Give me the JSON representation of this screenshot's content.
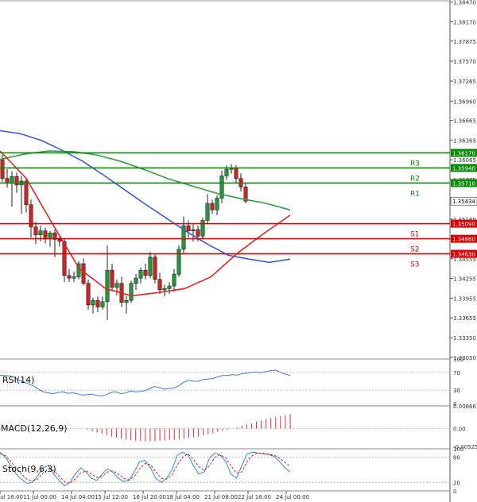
{
  "chart_data": {
    "type": "candlestick",
    "price_axis": {
      "ticks": [
        "1.38470",
        "1.38170",
        "1.37875",
        "1.37570",
        "1.37265",
        "1.36960",
        "1.36665",
        "1.36365",
        "1.36065",
        "1.35765",
        "1.35160",
        "1.34855",
        "1.34555",
        "1.34255",
        "1.33955",
        "1.33655",
        "1.33350",
        "1.33050"
      ],
      "tick_values": [
        1.3847,
        1.3817,
        1.37875,
        1.3757,
        1.37265,
        1.3696,
        1.36665,
        1.36365,
        1.36065,
        1.35765,
        1.3516,
        1.34855,
        1.34555,
        1.34255,
        1.33955,
        1.33655,
        1.3335,
        1.3305
      ],
      "ylim": [
        1.3305,
        1.3849
      ]
    },
    "time_axis": {
      "labels": [
        "10 Jul 16:00",
        "11 Jul 00:00",
        "14 Jul 04:00",
        "15 Jul 12:00",
        "16 Jul 20:00",
        "18 Jul 04:00",
        "21 Jul 08:00",
        "22 Jul 16:00",
        "24 Jul 00:00"
      ],
      "label_index": [
        0,
        7,
        15,
        22,
        30,
        37,
        45,
        52,
        60
      ]
    },
    "levels": [
      {
        "name": "R3",
        "value": 1.3617,
        "tag": "1.36170",
        "color": "#0a8a0a"
      },
      {
        "name": "R2",
        "value": 1.3594,
        "tag": "1.35940",
        "color": "#0a8a0a"
      },
      {
        "name": "R1",
        "value": 1.3571,
        "tag": "1.35710",
        "color": "#0a8a0a"
      },
      {
        "name": "S1",
        "value": 1.3509,
        "tag": "1.35090",
        "color": "#dd0000"
      },
      {
        "name": "S2",
        "value": 1.3486,
        "tag": "1.34860",
        "color": "#dd0000"
      },
      {
        "name": "S3",
        "value": 1.3463,
        "tag": "1.34630",
        "color": "#dd0000"
      }
    ],
    "current_price": {
      "value": 1.35434,
      "tag": "1.35434"
    },
    "candles": [
      [
        1.3608,
        1.3614,
        1.3573,
        1.3578
      ],
      [
        1.3578,
        1.3592,
        1.3564,
        1.3571
      ],
      [
        1.3571,
        1.3589,
        1.3535,
        1.3581
      ],
      [
        1.3581,
        1.3587,
        1.3556,
        1.3568
      ],
      [
        1.3568,
        1.3582,
        1.3524,
        1.3574
      ],
      [
        1.3574,
        1.3578,
        1.3526,
        1.3538
      ],
      [
        1.3538,
        1.3546,
        1.3488,
        1.3504
      ],
      [
        1.3504,
        1.3512,
        1.3478,
        1.3492
      ],
      [
        1.3492,
        1.3506,
        1.3482,
        1.3498
      ],
      [
        1.3498,
        1.3503,
        1.3479,
        1.3488
      ],
      [
        1.3488,
        1.3498,
        1.3474,
        1.3495
      ],
      [
        1.3495,
        1.35,
        1.3458,
        1.3485
      ],
      [
        1.3485,
        1.3492,
        1.3474,
        1.3482
      ],
      [
        1.3482,
        1.3486,
        1.342,
        1.343
      ],
      [
        1.343,
        1.344,
        1.342,
        1.3426
      ],
      [
        1.3426,
        1.3436,
        1.342,
        1.3428
      ],
      [
        1.3428,
        1.3452,
        1.3424,
        1.3448
      ],
      [
        1.3448,
        1.3456,
        1.3415,
        1.3418
      ],
      [
        1.3418,
        1.3424,
        1.3378,
        1.3385
      ],
      [
        1.3385,
        1.3396,
        1.3372,
        1.3392
      ],
      [
        1.3392,
        1.3398,
        1.3374,
        1.3382
      ],
      [
        1.3382,
        1.3398,
        1.3378,
        1.339
      ],
      [
        1.339,
        1.3476,
        1.3362,
        1.3438
      ],
      [
        1.3438,
        1.3448,
        1.3406,
        1.3412
      ],
      [
        1.3412,
        1.3424,
        1.34,
        1.3418
      ],
      [
        1.3418,
        1.3428,
        1.3382,
        1.3389
      ],
      [
        1.3389,
        1.3399,
        1.3372,
        1.3392
      ],
      [
        1.3392,
        1.3422,
        1.3388,
        1.3418
      ],
      [
        1.3418,
        1.3432,
        1.3408,
        1.3426
      ],
      [
        1.3426,
        1.3442,
        1.3418,
        1.3438
      ],
      [
        1.3438,
        1.3448,
        1.3424,
        1.343
      ],
      [
        1.343,
        1.3466,
        1.3426,
        1.3458
      ],
      [
        1.3458,
        1.3462,
        1.3418,
        1.3424
      ],
      [
        1.3424,
        1.3434,
        1.3402,
        1.3408
      ],
      [
        1.3408,
        1.3416,
        1.3398,
        1.341
      ],
      [
        1.341,
        1.342,
        1.3402,
        1.3414
      ],
      [
        1.3414,
        1.344,
        1.3405,
        1.3432
      ],
      [
        1.3432,
        1.3476,
        1.3428,
        1.347
      ],
      [
        1.347,
        1.352,
        1.3462,
        1.3506
      ],
      [
        1.3506,
        1.3514,
        1.3488,
        1.3498
      ],
      [
        1.3498,
        1.3508,
        1.3482,
        1.35
      ],
      [
        1.35,
        1.3506,
        1.3482,
        1.349
      ],
      [
        1.349,
        1.3518,
        1.3486,
        1.3514
      ],
      [
        1.3514,
        1.3554,
        1.3508,
        1.354
      ],
      [
        1.354,
        1.3546,
        1.3524,
        1.353
      ],
      [
        1.353,
        1.3552,
        1.3522,
        1.3548
      ],
      [
        1.3548,
        1.359,
        1.354,
        1.3582
      ],
      [
        1.3582,
        1.3598,
        1.3576,
        1.3592
      ],
      [
        1.3592,
        1.36,
        1.3585,
        1.3594
      ],
      [
        1.3594,
        1.3598,
        1.357,
        1.3578
      ],
      [
        1.3578,
        1.3586,
        1.3558,
        1.3565
      ],
      [
        1.3565,
        1.3571,
        1.354,
        1.35434
      ]
    ],
    "moving_averages": [
      {
        "color": "#3b5bdb",
        "points": [
          1.3651,
          1.3646,
          1.3636,
          1.3621,
          1.3604,
          1.3583,
          1.3561,
          1.3539,
          1.3518,
          1.3497,
          1.3478,
          1.3461,
          1.3455,
          1.345,
          1.3455
        ]
      },
      {
        "color": "#2e9e3e",
        "points": [
          1.3607,
          1.3615,
          1.362,
          1.3619,
          1.3614,
          1.3604,
          1.3591,
          1.3577,
          1.3566,
          1.3555,
          1.3547,
          1.354,
          1.353
        ]
      },
      {
        "color": "#e8231f",
        "points": [
          1.362,
          1.3578,
          1.3508,
          1.3441,
          1.341,
          1.3399,
          1.3404,
          1.341,
          1.3428,
          1.3464,
          1.3494,
          1.3522
        ]
      }
    ],
    "indicators": [
      {
        "name": "RSI(14)",
        "ticks": [
          "100",
          "70",
          "30",
          "0"
        ],
        "color": "#3b7be8",
        "values": [
          64,
          63,
          62,
          58,
          52,
          48,
          44,
          39,
          32,
          26,
          24,
          22,
          25,
          26,
          23,
          24,
          22,
          19,
          20,
          21,
          18,
          17,
          20,
          25,
          26,
          22,
          24,
          28,
          26,
          27,
          29,
          34,
          38,
          36,
          32,
          34,
          35,
          40,
          48,
          52,
          50,
          50,
          54,
          55,
          56,
          60,
          63,
          63,
          65,
          64,
          67,
          68,
          70,
          71,
          69,
          72,
          74,
          75,
          70,
          66,
          63
        ]
      },
      {
        "name": "MACD(12,26,9)",
        "ticks": [
          "0.00666",
          "0.00",
          "-0.005252"
        ],
        "color": "#d33",
        "values": [
          -0.0004,
          -0.0008,
          -0.0012,
          -0.0016,
          -0.002,
          -0.0024,
          -0.0027,
          -0.003,
          -0.0032,
          -0.0034,
          -0.0036,
          -0.0037,
          -0.0038,
          -0.0038,
          -0.0037,
          -0.0036,
          -0.0035,
          -0.0034,
          -0.0033,
          -0.0032,
          -0.003,
          -0.0028,
          -0.0026,
          -0.0023,
          -0.002,
          -0.0017,
          -0.0014,
          -0.001,
          -0.0007,
          -0.0004,
          0.0,
          0.0004,
          0.0008,
          0.0012,
          0.0016,
          0.002,
          0.0024,
          0.0028,
          0.0031,
          0.0034,
          0.0037,
          0.0039,
          0.0042
        ]
      },
      {
        "name": "Stoch(9,6,3)",
        "ticks": [
          "100",
          "80",
          "20",
          "0"
        ],
        "colors": [
          "#2c8fd6",
          "#e02020"
        ],
        "k": [
          92,
          80,
          60,
          40,
          28,
          18,
          20,
          35,
          55,
          60,
          40,
          25,
          12,
          20,
          40,
          55,
          45,
          30,
          25,
          40,
          52,
          45,
          30,
          22,
          25,
          45,
          70,
          72,
          55,
          30,
          20,
          30,
          50,
          85,
          92,
          85,
          60,
          40,
          45,
          78,
          90,
          85,
          70,
          40,
          30,
          60,
          88,
          92,
          90,
          88,
          86,
          82,
          70,
          55,
          45
        ],
        "d": [
          88,
          84,
          70,
          55,
          40,
          28,
          24,
          28,
          42,
          52,
          48,
          35,
          22,
          18,
          28,
          42,
          48,
          40,
          32,
          34,
          45,
          48,
          40,
          30,
          26,
          34,
          52,
          65,
          62,
          45,
          30,
          28,
          38,
          62,
          80,
          88,
          75,
          58,
          48,
          60,
          80,
          86,
          78,
          60,
          42,
          45,
          70,
          85,
          90,
          89,
          87,
          85,
          78,
          68,
          58
        ]
      }
    ]
  }
}
